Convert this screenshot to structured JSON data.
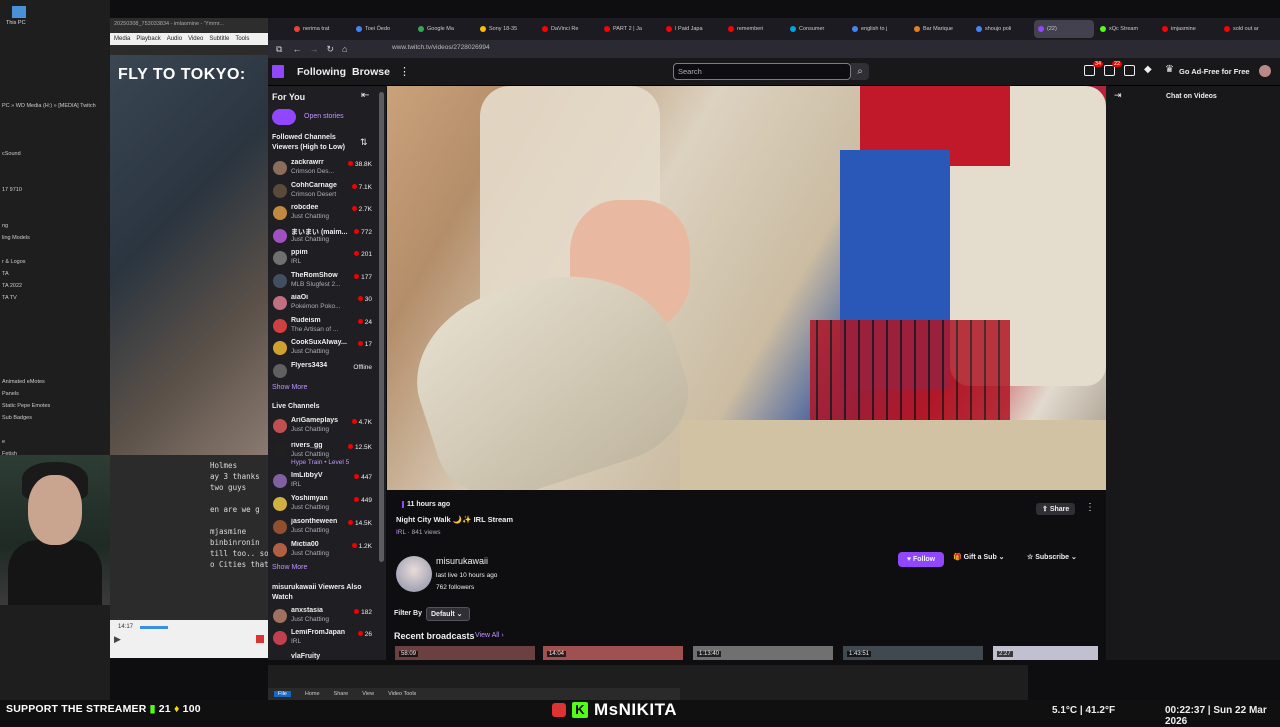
{
  "desktop": {
    "label_pc": "This PC",
    "items": [
      "PC » WD Media (H:) » [MEDIA] Twitch",
      "",
      "",
      "",
      "cSound",
      "",
      "",
      "17 9710",
      "",
      "",
      "ng",
      "ling Models",
      "",
      "r & Logos",
      "TA",
      "TA 2022",
      "TA TV",
      "",
      "",
      "",
      "",
      "",
      "",
      "Animated eMotes",
      "Panels",
      "Static Pepe Emotes",
      "Sub Badges",
      "",
      "e",
      "Fetish",
      "ey Online"
    ]
  },
  "media_player": {
    "title_bar": "20250308_753033834 - imlaomine - 'Ymmr...",
    "menu": [
      "Media",
      "Playback",
      "Audio",
      "Video",
      "Subtitle",
      "Tools"
    ],
    "overlay_title": "FLY TO TOKYO:",
    "time": "14:17"
  },
  "chat_overlay": [
    "Holmes",
    "ay 3 thanks",
    "two guys",
    "",
    "en are we g",
    "",
    "mjasmine",
    "binbinronin",
    "till too.. so",
    "o Cities that"
  ],
  "browser": {
    "tabs": [
      {
        "label": "nerima trat",
        "color": "#ea4335"
      },
      {
        "label": "Toei Ōedo",
        "color": "#4285f4"
      },
      {
        "label": "Google Ma",
        "color": "#34a853"
      },
      {
        "label": "Sony 18-35",
        "color": "#fbbc05"
      },
      {
        "label": "DaVinci Re",
        "color": "#ff0000"
      },
      {
        "label": "PART 2 | Ja",
        "color": "#ff0000"
      },
      {
        "label": "I Paid Japa",
        "color": "#ff0000"
      },
      {
        "label": "rememberi",
        "color": "#ff0000"
      },
      {
        "label": "Consumer",
        "color": "#00a1de"
      },
      {
        "label": "english to j",
        "color": "#4285f4"
      },
      {
        "label": "Bar Marique",
        "color": "#e67e22"
      },
      {
        "label": "shoujo poli",
        "color": "#4285f4"
      },
      {
        "label": "(22)",
        "color": "#9147ff",
        "active": true
      },
      {
        "label": "xQc Stream",
        "color": "#53fc18"
      },
      {
        "label": "imjasmine",
        "color": "#ff0000"
      },
      {
        "label": "sold out ar",
        "color": "#ff0000"
      }
    ],
    "url": "www.twitch.tv/videos/2728026994"
  },
  "twitch": {
    "nav": {
      "following": "Following",
      "browse": "Browse",
      "more": "⋮",
      "search_placeholder": "Search",
      "adfree": "Go Ad-Free for Free",
      "badge1": "34",
      "badge2": "22"
    },
    "sidebar": {
      "for_you": "For You",
      "open_stories": "Open stories",
      "followed_header": "Followed Channels Viewers (High to Low)",
      "followed": [
        {
          "name": "zackrawrr",
          "cat": "Crimson Des...",
          "viewers": "38.8K",
          "color": "#8a6d5a"
        },
        {
          "name": "CohhCarnage",
          "cat": "Crimson Desert",
          "viewers": "7.1K",
          "color": "#5a4a3a"
        },
        {
          "name": "robcdee",
          "cat": "Just Chatting",
          "viewers": "2.7K",
          "color": "#c08a40"
        },
        {
          "name": "まいまい (maim...",
          "cat": "Just Chatting",
          "viewers": "772",
          "color": "#a050c0"
        },
        {
          "name": "ppim",
          "cat": "IRL",
          "viewers": "201",
          "color": "#707070"
        },
        {
          "name": "TheRomShow",
          "cat": "MLB Slugfest 2...",
          "viewers": "177",
          "color": "#405060"
        },
        {
          "name": "aiaOi",
          "cat": "Pokémon Poko...",
          "viewers": "30",
          "color": "#c07080"
        },
        {
          "name": "Rudeism",
          "cat": "The Artisan of ...",
          "viewers": "24",
          "color": "#d04040"
        },
        {
          "name": "CookSuxAlway...",
          "cat": "Just Chatting",
          "viewers": "17",
          "color": "#d0a030"
        },
        {
          "name": "Flyers3434",
          "cat": "",
          "viewers": "Offline",
          "color": "#606060"
        }
      ],
      "show_more": "Show More",
      "live_header": "Live Channels",
      "live": [
        {
          "name": "AriGameplays",
          "cat": "Just Chatting",
          "viewers": "4.7K",
          "color": "#c05050"
        },
        {
          "name": "rivers_gg",
          "cat": "Just Chatting",
          "viewers": "12.5K",
          "color": "#202020"
        },
        {
          "name": "ImLibbyV",
          "cat": "IRL",
          "viewers": "447",
          "color": "#8060a0"
        },
        {
          "name": "Yoshimyan",
          "cat": "Just Chatting",
          "viewers": "449",
          "color": "#d0b040"
        },
        {
          "name": "jasontheween",
          "cat": "Just Chatting",
          "viewers": "14.5K",
          "color": "#905030"
        },
        {
          "name": "Mictia00",
          "cat": "Just Chatting",
          "viewers": "1.2K",
          "color": "#b06040"
        }
      ],
      "hype_train": "Hype Train • Level 5",
      "also_header": "misurukawaii Viewers Also Watch",
      "also": [
        {
          "name": "anxstasia",
          "cat": "Just Chatting",
          "viewers": "182",
          "color": "#a07060"
        },
        {
          "name": "LemiFromJapan",
          "cat": "IRL",
          "viewers": "26",
          "color": "#c04050"
        }
      ],
      "cut_off": "vlaFruity"
    },
    "chat_panel": {
      "title": "Chat on Videos"
    },
    "video": {
      "ago": "11 hours ago",
      "title": "Night City Walk 🌙✨ IRL Stream",
      "category": "IRL",
      "views": " · 841 views",
      "share": "Share",
      "channel": "misurukawaii",
      "last_live": "last live 10 hours ago",
      "followers": "762 followers",
      "follow": "Follow",
      "gift": "Gift a Sub",
      "subscribe": "Subscribe",
      "filter_label": "Filter By",
      "filter_value": "Default",
      "recent": "Recent broadcasts",
      "view_all": "View All",
      "thumbs": [
        {
          "d": "58:09",
          "c": "#6a4040"
        },
        {
          "d": "14:04",
          "c": "#a05050"
        },
        {
          "d": "1:13:40",
          "c": "#707070"
        },
        {
          "d": "1:43:51",
          "c": "#404850"
        },
        {
          "d": "2:27",
          "c": "#c0c0d0"
        }
      ]
    }
  },
  "explorer": {
    "ribbon": [
      "File",
      "Home",
      "Share",
      "View",
      "Video Tools"
    ],
    "active": "File"
  },
  "taskbar": {
    "support": "SUPPORT THE STREAMER",
    "kick_count": "21",
    "kick_count2": "100",
    "streamer": "MsNIKITA",
    "weather": "5.1°C | 41.2°F",
    "clock": "00:22:37 | Sun 22 Mar 2026"
  }
}
